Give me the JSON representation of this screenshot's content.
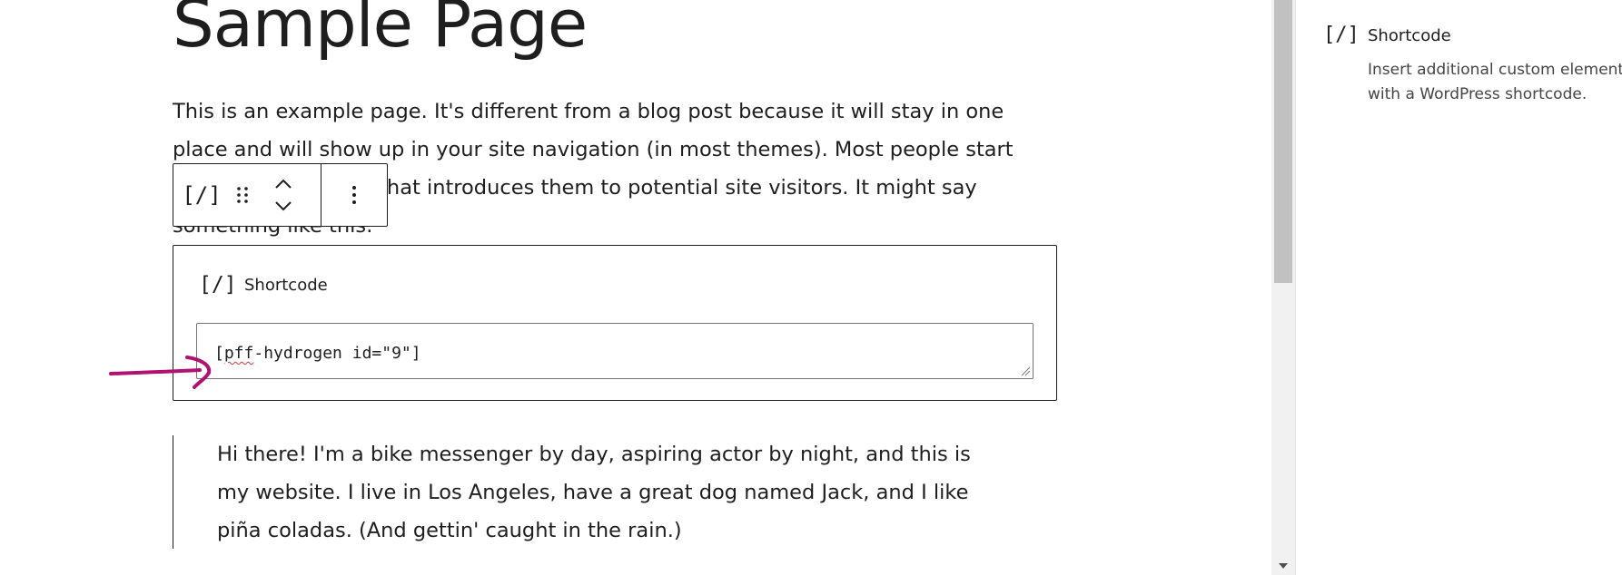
{
  "editor": {
    "page_title": "Sample Page",
    "intro_lines": [
      "This is an example page. It's different from a blog post because it will stay in one",
      "place and will show up in your site navigation (in most themes). Most people start",
      "with an About page that introduces them to potential site visitors. It might say",
      "something like this:"
    ],
    "quote_lines": [
      "Hi there! I'm a bike messenger by day, aspiring actor by night, and this is",
      "my website. I live in Los Angeles, have a great dog named Jack, and I like",
      "piña coladas. (And gettin' caught in the rain.)"
    ]
  },
  "toolbar": {
    "block_icon": "[/]",
    "icons": [
      "shortcode-icon",
      "drag-handle-icon",
      "move-up-icon",
      "move-down-icon",
      "more-options-icon"
    ]
  },
  "shortcode_block": {
    "icon": "[/]",
    "label": "Shortcode",
    "value_part1": "[",
    "value_squiggle": "pff",
    "value_part2": "-hydrogen id=\"9\"]"
  },
  "annotation": {
    "color": "#b0126f",
    "icon": "arrow-annotation-icon"
  },
  "sidebar": {
    "icon": "[/]",
    "title": "Shortcode",
    "description_lines": [
      "Insert additional custom elements",
      "with a WordPress shortcode."
    ]
  }
}
